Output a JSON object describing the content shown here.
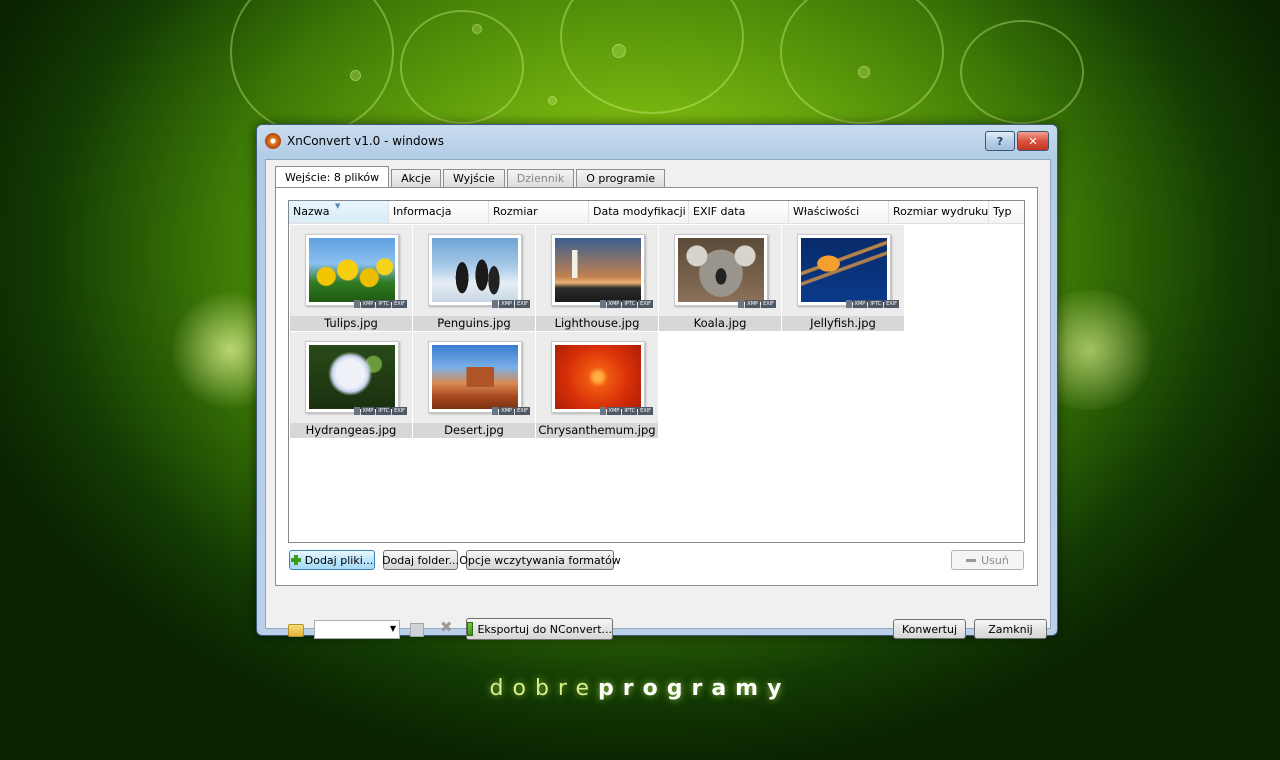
{
  "desktop": {
    "brand_light": "dobre",
    "brand_bold": "programy"
  },
  "window": {
    "title": "XnConvert v1.0 - windows",
    "help_label": "?",
    "close_label": "✕"
  },
  "tabs": [
    {
      "label": "Wejście: 8 plików",
      "active": true
    },
    {
      "label": "Akcje"
    },
    {
      "label": "Wyjście"
    },
    {
      "label": "Dziennik",
      "disabled": true
    },
    {
      "label": "O programie"
    }
  ],
  "columns": [
    "Nazwa",
    "Informacja",
    "Rozmiar",
    "Data modyfikacji",
    "EXIF data",
    "Właściwości",
    "Rozmiar wydruku",
    "Typ"
  ],
  "files": [
    {
      "name": "Tulips.jpg",
      "badges": [
        "XMP",
        "IPTC",
        "EXIF"
      ],
      "thumb": "tulips"
    },
    {
      "name": "Penguins.jpg",
      "badges": [
        "XMP",
        "EXIF"
      ],
      "thumb": "penguins"
    },
    {
      "name": "Lighthouse.jpg",
      "badges": [
        "XMP",
        "IPTC",
        "EXIF"
      ],
      "thumb": "lighthouse"
    },
    {
      "name": "Koala.jpg",
      "badges": [
        "XMP",
        "EXIF"
      ],
      "thumb": "koala"
    },
    {
      "name": "Jellyfish.jpg",
      "badges": [
        "XMP",
        "IPTC",
        "EXIF"
      ],
      "thumb": "jellyfish"
    },
    {
      "name": "Hydrangeas.jpg",
      "badges": [
        "XMP",
        "IPTC",
        "EXIF"
      ],
      "thumb": "hydrangeas"
    },
    {
      "name": "Desert.jpg",
      "badges": [
        "XMP",
        "EXIF"
      ],
      "thumb": "desert"
    },
    {
      "name": "Chrysanthemum.jpg",
      "badges": [
        "XMP",
        "IPTC",
        "EXIF"
      ],
      "thumb": "chrysanthemum"
    }
  ],
  "buttons": {
    "add_files": "Dodaj pliki...",
    "add_folder": "Dodaj folder...",
    "load_options": "Opcje wczytywania formatów",
    "remove": "Usuń",
    "export": "Eksportuj do NConvert...",
    "convert": "Konwertuj",
    "close": "Zamknij"
  },
  "preset_combo": {
    "value": ""
  }
}
